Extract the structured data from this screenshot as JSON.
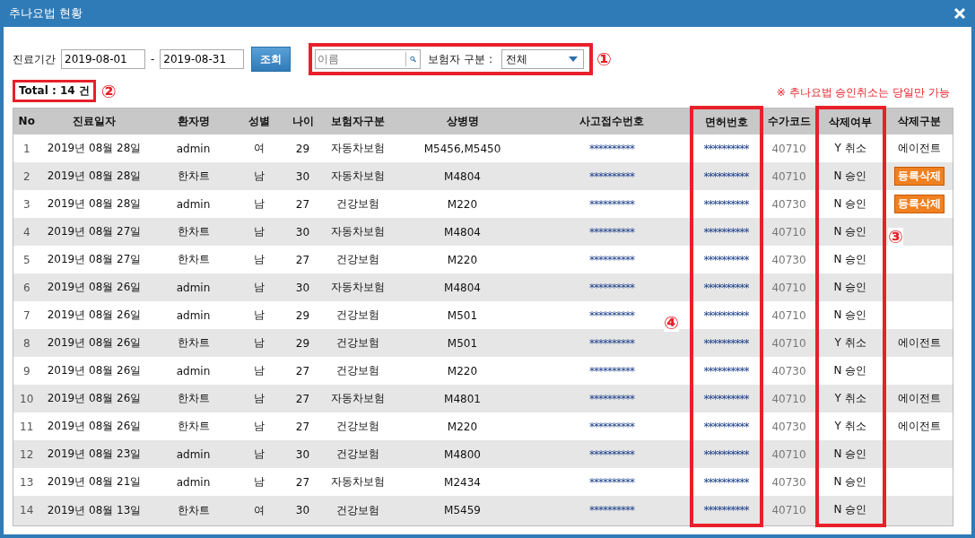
{
  "window": {
    "title": "추나요법 현황"
  },
  "filter": {
    "period_label": "진료기간",
    "date_from": "2019-08-01",
    "separator": "-",
    "date_to": "2019-08-31",
    "search_button": "조회",
    "name_placeholder": "이름",
    "insurer_label": "보험자 구분 :",
    "insurer_value": "전체",
    "marker": "①"
  },
  "total": {
    "text": "Total :  14 건",
    "marker": "②"
  },
  "notice": "※ 추나요법 승인취소는 당일만 가능",
  "table": {
    "columns": [
      {
        "label": "No",
        "highlighted": false
      },
      {
        "label": "진료일자",
        "highlighted": false
      },
      {
        "label": "환자명",
        "highlighted": false
      },
      {
        "label": "성별",
        "highlighted": false
      },
      {
        "label": "나이",
        "highlighted": false
      },
      {
        "label": "보험자구분",
        "highlighted": false
      },
      {
        "label": "상병명",
        "highlighted": false
      },
      {
        "label": "사고접수번호",
        "highlighted": false
      },
      {
        "label": "면허번호",
        "highlighted": true,
        "marker": "④"
      },
      {
        "label": "수가코드",
        "highlighted": false
      },
      {
        "label": "삭제여부",
        "highlighted": true,
        "marker": "③"
      },
      {
        "label": "삭제구분",
        "highlighted": false
      }
    ],
    "rows": [
      {
        "cells": [
          "1",
          "2019년 08월 28일",
          "admin",
          "여",
          "29",
          "자동차보험",
          "M5456,M5450",
          "**********",
          "**********",
          "40710",
          "Y 취소"
        ],
        "delete_type": {
          "kind": "text",
          "label": "에이전트"
        }
      },
      {
        "cells": [
          "2",
          "2019년 08월 28일",
          "한차트",
          "남",
          "30",
          "자동차보험",
          "M4804",
          "**********",
          "**********",
          "40710",
          "N 승인"
        ],
        "delete_type": {
          "kind": "button",
          "label": "등록삭제"
        }
      },
      {
        "cells": [
          "3",
          "2019년 08월 28일",
          "admin",
          "남",
          "27",
          "건강보험",
          "M220",
          "**********",
          "**********",
          "40730",
          "N 승인"
        ],
        "delete_type": {
          "kind": "button",
          "label": "등록삭제"
        }
      },
      {
        "cells": [
          "4",
          "2019년 08월 27일",
          "한차트",
          "남",
          "30",
          "자동차보험",
          "M4804",
          "**********",
          "**********",
          "40710",
          "N 승인"
        ]
      },
      {
        "cells": [
          "5",
          "2019년 08월 27일",
          "한차트",
          "남",
          "27",
          "건강보험",
          "M220",
          "**********",
          "**********",
          "40730",
          "N 승인"
        ]
      },
      {
        "cells": [
          "6",
          "2019년 08월 26일",
          "admin",
          "남",
          "30",
          "자동차보험",
          "M4804",
          "**********",
          "**********",
          "40710",
          "N 승인"
        ]
      },
      {
        "cells": [
          "7",
          "2019년 08월 26일",
          "admin",
          "남",
          "29",
          "건강보험",
          "M501",
          "**********",
          "**********",
          "40710",
          "N 승인"
        ]
      },
      {
        "cells": [
          "8",
          "2019년 08월 26일",
          "한차트",
          "남",
          "29",
          "건강보험",
          "M501",
          "**********",
          "**********",
          "40710",
          "Y 취소"
        ],
        "delete_type": {
          "kind": "text",
          "label": "에이전트"
        }
      },
      {
        "cells": [
          "9",
          "2019년 08월 26일",
          "admin",
          "남",
          "27",
          "건강보험",
          "M220",
          "**********",
          "**********",
          "40730",
          "N 승인"
        ]
      },
      {
        "cells": [
          "10",
          "2019년 08월 26일",
          "한차트",
          "남",
          "27",
          "자동차보험",
          "M4801",
          "**********",
          "**********",
          "40710",
          "Y 취소"
        ],
        "delete_type": {
          "kind": "text",
          "label": "에이전트"
        }
      },
      {
        "cells": [
          "11",
          "2019년 08월 26일",
          "한차트",
          "남",
          "27",
          "건강보험",
          "M220",
          "**********",
          "**********",
          "40730",
          "Y 취소"
        ],
        "delete_type": {
          "kind": "text",
          "label": "에이전트"
        }
      },
      {
        "cells": [
          "12",
          "2019년 08월 23일",
          "admin",
          "남",
          "30",
          "건강보험",
          "M4800",
          "**********",
          "**********",
          "40710",
          "N 승인"
        ]
      },
      {
        "cells": [
          "13",
          "2019년 08월 21일",
          "admin",
          "남",
          "27",
          "자동차보험",
          "M2434",
          "**********",
          "**********",
          "40730",
          "N 승인"
        ]
      },
      {
        "cells": [
          "14",
          "2019년 08월 13일",
          "한차트",
          "여",
          "30",
          "건강보험",
          "M5459",
          "**********",
          "**********",
          "40710",
          "N 승인"
        ]
      }
    ]
  }
}
